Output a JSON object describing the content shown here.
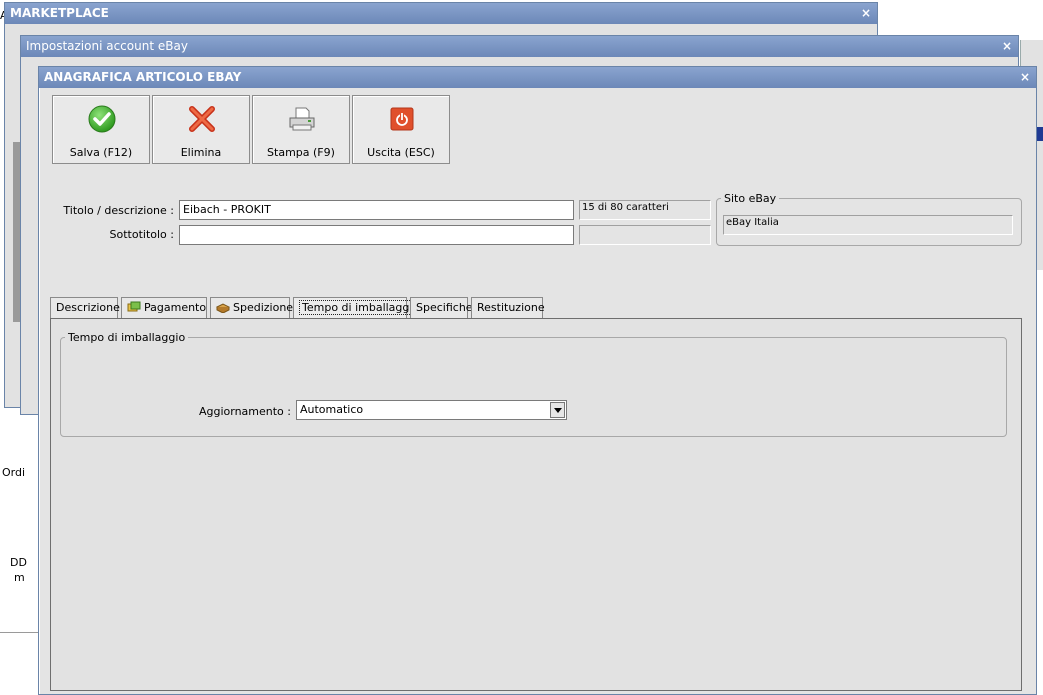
{
  "windows": {
    "marketplace": {
      "title": "MARKETPLACE"
    },
    "account": {
      "title": "Impostazioni account eBay"
    },
    "item": {
      "title": "ANAGRAFICA ARTICOLO EBAY"
    }
  },
  "close_glyph": "×",
  "background_text": {
    "ordi": "Ordi",
    "dd": "DD",
    "m": "m",
    "a": "A"
  },
  "toolbar": {
    "save_label": "Salva (F12)",
    "delete_label": "Elimina",
    "print_label": "Stampa (F9)",
    "exit_label": "Uscita (ESC)"
  },
  "form": {
    "title_label": "Titolo / descrizione :",
    "title_value": "Eibach - PROKIT",
    "title_counter": "15 di 80 caratteri",
    "subtitle_label": "Sottotitolo :",
    "subtitle_value": "",
    "subtitle_counter": "",
    "site_group_label": "Sito eBay",
    "site_value": "eBay Italia"
  },
  "tabs": [
    {
      "label": "Descrizione",
      "icon": "none"
    },
    {
      "label": "Pagamento",
      "icon": "payment-icon"
    },
    {
      "label": "Spedizione",
      "icon": "shipping-icon"
    },
    {
      "label": "Tempo di imballaggio",
      "icon": "none",
      "active": true
    },
    {
      "label": "Specifiche",
      "icon": "none"
    },
    {
      "label": "Restituzione",
      "icon": "none"
    }
  ],
  "panel": {
    "group_label": "Tempo di imballaggio",
    "update_label": "Aggiornamento :",
    "update_value": "Automatico"
  },
  "colors": {
    "titlebar": "#7490c0",
    "window_bg": "#e2e2e2",
    "accent_blue": "#1f3a93"
  }
}
